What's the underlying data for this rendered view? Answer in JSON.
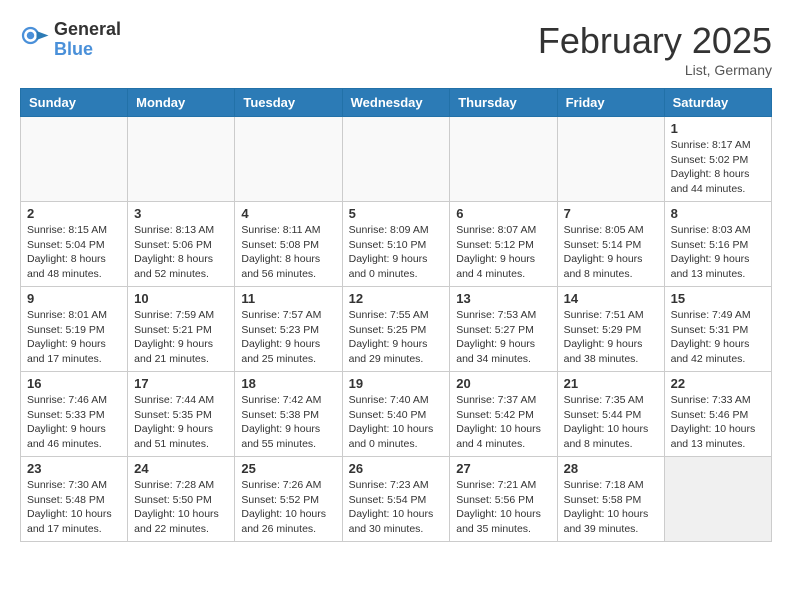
{
  "header": {
    "logo_general": "General",
    "logo_blue": "Blue",
    "title": "February 2025",
    "location": "List, Germany"
  },
  "weekdays": [
    "Sunday",
    "Monday",
    "Tuesday",
    "Wednesday",
    "Thursday",
    "Friday",
    "Saturday"
  ],
  "weeks": [
    [
      {
        "day": "",
        "info": ""
      },
      {
        "day": "",
        "info": ""
      },
      {
        "day": "",
        "info": ""
      },
      {
        "day": "",
        "info": ""
      },
      {
        "day": "",
        "info": ""
      },
      {
        "day": "",
        "info": ""
      },
      {
        "day": "1",
        "info": "Sunrise: 8:17 AM\nSunset: 5:02 PM\nDaylight: 8 hours and 44 minutes."
      }
    ],
    [
      {
        "day": "2",
        "info": "Sunrise: 8:15 AM\nSunset: 5:04 PM\nDaylight: 8 hours and 48 minutes."
      },
      {
        "day": "3",
        "info": "Sunrise: 8:13 AM\nSunset: 5:06 PM\nDaylight: 8 hours and 52 minutes."
      },
      {
        "day": "4",
        "info": "Sunrise: 8:11 AM\nSunset: 5:08 PM\nDaylight: 8 hours and 56 minutes."
      },
      {
        "day": "5",
        "info": "Sunrise: 8:09 AM\nSunset: 5:10 PM\nDaylight: 9 hours and 0 minutes."
      },
      {
        "day": "6",
        "info": "Sunrise: 8:07 AM\nSunset: 5:12 PM\nDaylight: 9 hours and 4 minutes."
      },
      {
        "day": "7",
        "info": "Sunrise: 8:05 AM\nSunset: 5:14 PM\nDaylight: 9 hours and 8 minutes."
      },
      {
        "day": "8",
        "info": "Sunrise: 8:03 AM\nSunset: 5:16 PM\nDaylight: 9 hours and 13 minutes."
      }
    ],
    [
      {
        "day": "9",
        "info": "Sunrise: 8:01 AM\nSunset: 5:19 PM\nDaylight: 9 hours and 17 minutes."
      },
      {
        "day": "10",
        "info": "Sunrise: 7:59 AM\nSunset: 5:21 PM\nDaylight: 9 hours and 21 minutes."
      },
      {
        "day": "11",
        "info": "Sunrise: 7:57 AM\nSunset: 5:23 PM\nDaylight: 9 hours and 25 minutes."
      },
      {
        "day": "12",
        "info": "Sunrise: 7:55 AM\nSunset: 5:25 PM\nDaylight: 9 hours and 29 minutes."
      },
      {
        "day": "13",
        "info": "Sunrise: 7:53 AM\nSunset: 5:27 PM\nDaylight: 9 hours and 34 minutes."
      },
      {
        "day": "14",
        "info": "Sunrise: 7:51 AM\nSunset: 5:29 PM\nDaylight: 9 hours and 38 minutes."
      },
      {
        "day": "15",
        "info": "Sunrise: 7:49 AM\nSunset: 5:31 PM\nDaylight: 9 hours and 42 minutes."
      }
    ],
    [
      {
        "day": "16",
        "info": "Sunrise: 7:46 AM\nSunset: 5:33 PM\nDaylight: 9 hours and 46 minutes."
      },
      {
        "day": "17",
        "info": "Sunrise: 7:44 AM\nSunset: 5:35 PM\nDaylight: 9 hours and 51 minutes."
      },
      {
        "day": "18",
        "info": "Sunrise: 7:42 AM\nSunset: 5:38 PM\nDaylight: 9 hours and 55 minutes."
      },
      {
        "day": "19",
        "info": "Sunrise: 7:40 AM\nSunset: 5:40 PM\nDaylight: 10 hours and 0 minutes."
      },
      {
        "day": "20",
        "info": "Sunrise: 7:37 AM\nSunset: 5:42 PM\nDaylight: 10 hours and 4 minutes."
      },
      {
        "day": "21",
        "info": "Sunrise: 7:35 AM\nSunset: 5:44 PM\nDaylight: 10 hours and 8 minutes."
      },
      {
        "day": "22",
        "info": "Sunrise: 7:33 AM\nSunset: 5:46 PM\nDaylight: 10 hours and 13 minutes."
      }
    ],
    [
      {
        "day": "23",
        "info": "Sunrise: 7:30 AM\nSunset: 5:48 PM\nDaylight: 10 hours and 17 minutes."
      },
      {
        "day": "24",
        "info": "Sunrise: 7:28 AM\nSunset: 5:50 PM\nDaylight: 10 hours and 22 minutes."
      },
      {
        "day": "25",
        "info": "Sunrise: 7:26 AM\nSunset: 5:52 PM\nDaylight: 10 hours and 26 minutes."
      },
      {
        "day": "26",
        "info": "Sunrise: 7:23 AM\nSunset: 5:54 PM\nDaylight: 10 hours and 30 minutes."
      },
      {
        "day": "27",
        "info": "Sunrise: 7:21 AM\nSunset: 5:56 PM\nDaylight: 10 hours and 35 minutes."
      },
      {
        "day": "28",
        "info": "Sunrise: 7:18 AM\nSunset: 5:58 PM\nDaylight: 10 hours and 39 minutes."
      },
      {
        "day": "",
        "info": ""
      }
    ]
  ]
}
